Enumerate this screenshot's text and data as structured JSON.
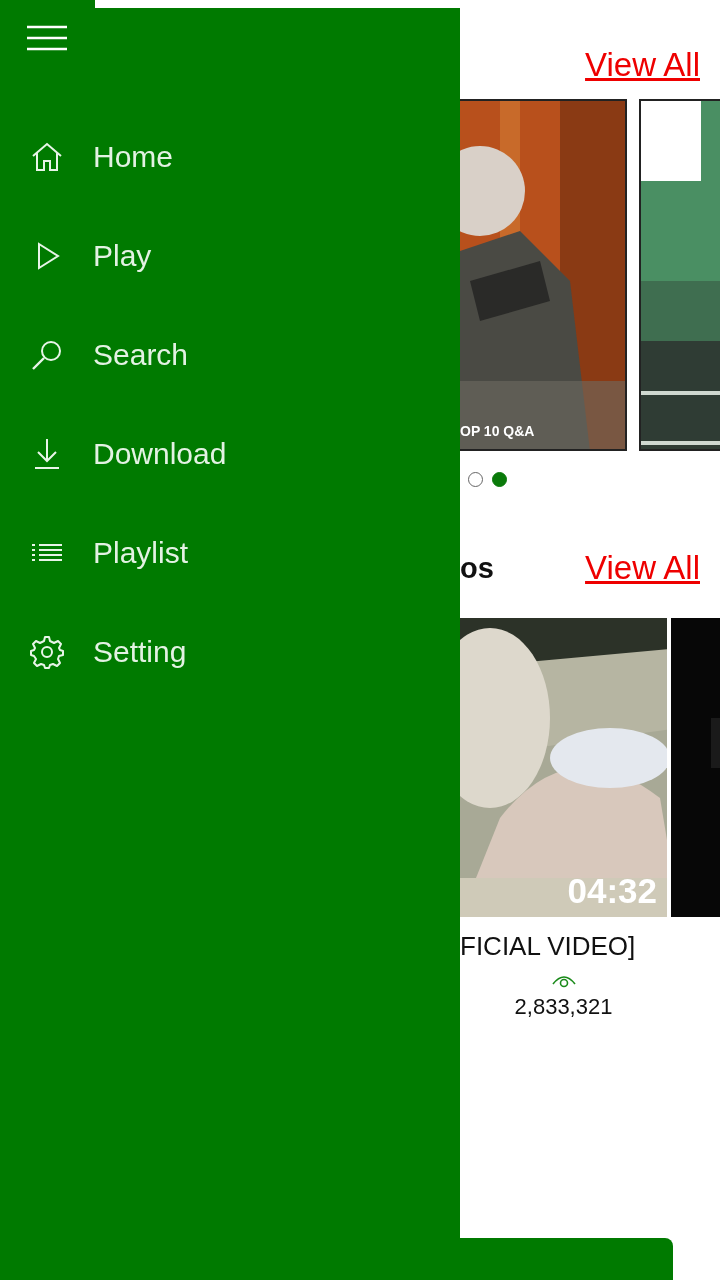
{
  "drawer": {
    "menu_items": [
      {
        "label": "Home"
      },
      {
        "label": "Play"
      },
      {
        "label": "Search"
      },
      {
        "label": "Download"
      },
      {
        "label": "Playlist"
      },
      {
        "label": "Setting"
      }
    ]
  },
  "featured": {
    "view_all": "View All",
    "cards": [
      {
        "kind": "picture",
        "caption": "OP 10 Q&A"
      },
      {
        "kind": "picture"
      }
    ],
    "dots": [
      {
        "selected": false
      },
      {
        "selected": true
      }
    ]
  },
  "videos": {
    "heading": "os",
    "view_all": "View All",
    "cards": [
      {
        "kind": "picture",
        "duration": "04:32",
        "title": "FICIAL VIDEO]",
        "views": "2,833,321"
      },
      {
        "kind": "picture"
      }
    ]
  },
  "bottom_bar": {
    "kind": "button"
  }
}
